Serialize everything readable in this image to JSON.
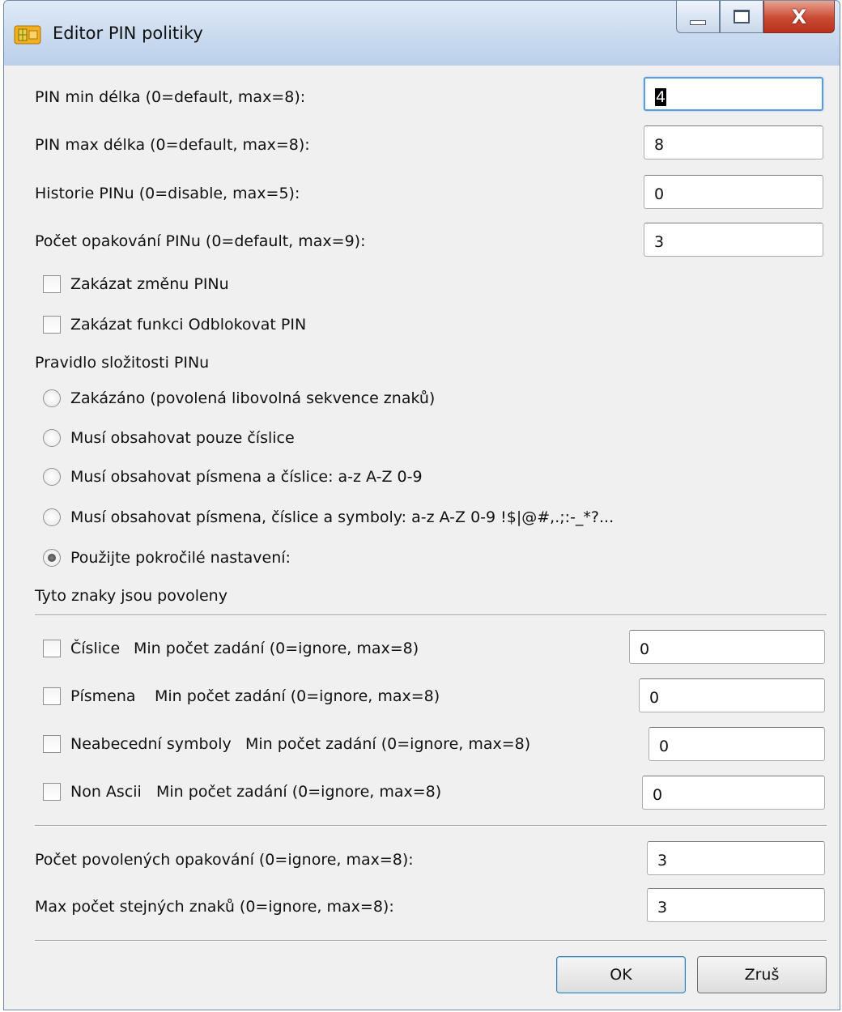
{
  "window": {
    "title": "Editor PIN politiky",
    "controls": {
      "minimize_icon": "minimize-icon",
      "maximize_icon": "maximize-icon",
      "close_glyph": "X"
    }
  },
  "policy_fields": [
    {
      "label": "PIN min délka (0=default, max=8):",
      "value": "4"
    },
    {
      "label": "PIN max délka (0=default, max=8):",
      "value": "8"
    },
    {
      "label": "Historie PINu (0=disable, max=5):",
      "value": "0"
    },
    {
      "label": "Počet opakování PINu (0=default, max=9):",
      "value": "3"
    }
  ],
  "checkboxes": [
    {
      "label": "Zakázat změnu PINu",
      "checked": false
    },
    {
      "label": "Zakázat funkci Odblokovat PIN",
      "checked": false
    }
  ],
  "complexity": {
    "heading": "Pravidlo složitosti PINu",
    "options": [
      {
        "label": "Zakázáno (povolená libovolná sekvence znaků)",
        "selected": false
      },
      {
        "label": "Musí obsahovat pouze číslice",
        "selected": false
      },
      {
        "label": "Musí obsahovat písmena a číslice: a-z A-Z 0-9",
        "selected": false
      },
      {
        "label": "Musí obsahovat písmena, číslice a symboly: a-z A-Z 0-9 !$|@#,.;:-_*?...",
        "selected": false
      },
      {
        "label": "Použijte pokročilé nastavení:",
        "selected": true
      }
    ]
  },
  "allowed_chars": {
    "heading": "Tyto znaky jsou povoleny",
    "rows": [
      {
        "name": "Číslice",
        "min_label": "Min počet zadání (0=ignore, max=8)",
        "value": "0",
        "checked": false
      },
      {
        "name": "Písmena",
        "min_label": "Min počet zadání (0=ignore, max=8)",
        "value": "0",
        "checked": false
      },
      {
        "name": "Neabecední symboly",
        "min_label": "Min počet zadání (0=ignore, max=8)",
        "value": "0",
        "checked": false
      },
      {
        "name": "Non Ascii",
        "min_label": "Min počet zadání (0=ignore, max=8)",
        "value": "0",
        "checked": false
      }
    ]
  },
  "repeat_fields": [
    {
      "label": "Počet povolených opakování (0=ignore, max=8):",
      "value": "3"
    },
    {
      "label": "Max počet stejných znaků (0=ignore, max=8):",
      "value": "3"
    }
  ],
  "buttons": {
    "ok": "OK",
    "cancel": "Zruš"
  },
  "colors": {
    "accent": "#5b9be0",
    "close": "#c94a33",
    "dialog_bg": "#f0f0f0"
  }
}
